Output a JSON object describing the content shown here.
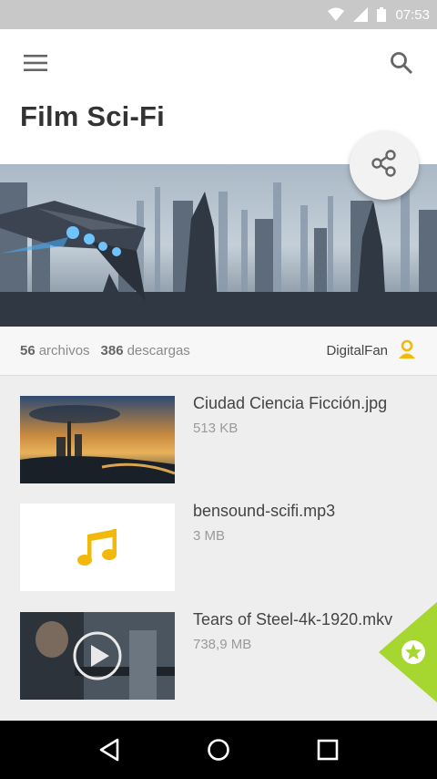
{
  "status_bar": {
    "time": "07:53"
  },
  "header": {
    "title": "Film Sci-Fi",
    "menu_icon": "hamburger-menu-icon",
    "search_icon": "search-icon"
  },
  "share_button": {
    "icon": "share-icon"
  },
  "stats": {
    "files_count": "56",
    "files_label": "archivos",
    "downloads_count": "386",
    "downloads_label": "descargas",
    "author": "DigitalFan"
  },
  "files": [
    {
      "name": "Ciudad Ciencia Ficción.jpg",
      "size": "513 KB",
      "type": "image"
    },
    {
      "name": "bensound-scifi.mp3",
      "size": "3 MB",
      "type": "audio"
    },
    {
      "name": "Tears of Steel-4k-1920.mkv",
      "size": "738,9 MB",
      "type": "video"
    }
  ],
  "colors": {
    "accent_yellow": "#f2b90c",
    "accent_green": "#a6d630",
    "status_bar": "#c8c8c8"
  }
}
